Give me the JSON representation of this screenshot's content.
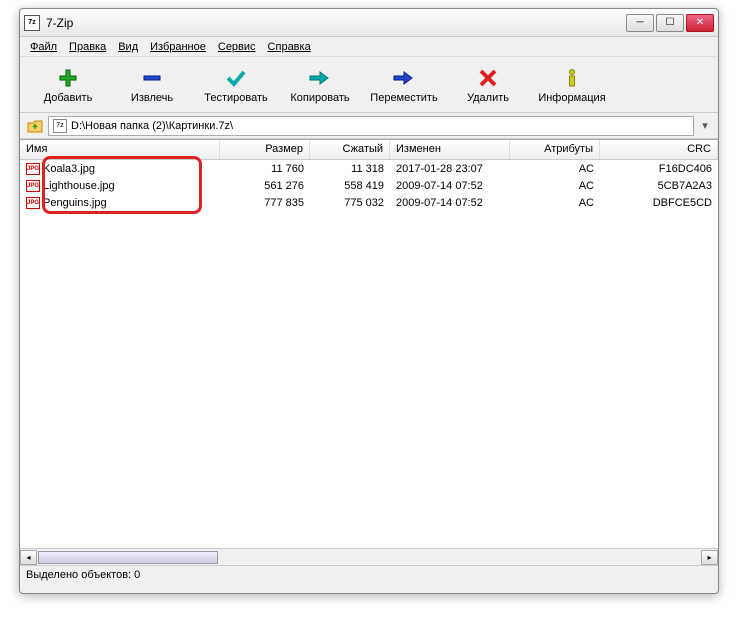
{
  "titlebar": {
    "icon_text": "7z",
    "title": "7-Zip"
  },
  "menu": {
    "file": "Файл",
    "edit": "Правка",
    "view": "Вид",
    "favorites": "Избранное",
    "tools": "Сервис",
    "help": "Справка"
  },
  "toolbar": {
    "add": "Добавить",
    "extract": "Извлечь",
    "test": "Тестировать",
    "copy": "Копировать",
    "move": "Переместить",
    "delete": "Удалить",
    "info": "Информация"
  },
  "address": {
    "path": "D:\\Новая папка (2)\\Картинки.7z\\",
    "icon_text": "7z"
  },
  "columns": {
    "name": "Имя",
    "size": "Размер",
    "packed": "Сжатый",
    "modified": "Изменен",
    "attributes": "Атрибуты",
    "crc": "CRC"
  },
  "files": [
    {
      "name": "Koala3.jpg",
      "size": "11 760",
      "packed": "11 318",
      "modified": "2017-01-28 23:07",
      "attributes": "AC",
      "crc": "F16DC406"
    },
    {
      "name": "Lighthouse.jpg",
      "size": "561 276",
      "packed": "558 419",
      "modified": "2009-07-14 07:52",
      "attributes": "AC",
      "crc": "5CB7A2A3"
    },
    {
      "name": "Penguins.jpg",
      "size": "777 835",
      "packed": "775 032",
      "modified": "2009-07-14 07:52",
      "attributes": "AC",
      "crc": "DBFCE5CD"
    }
  ],
  "status": {
    "text": "Выделено объектов: 0"
  },
  "colors": {
    "accent_red": "#d22",
    "plus_green": "#2a2",
    "minus_blue": "#24c",
    "test_teal": "#1aa",
    "copy_cyan": "#0aa",
    "move_blue": "#24c",
    "del_red": "#d22",
    "info_yellow": "#cc2"
  }
}
